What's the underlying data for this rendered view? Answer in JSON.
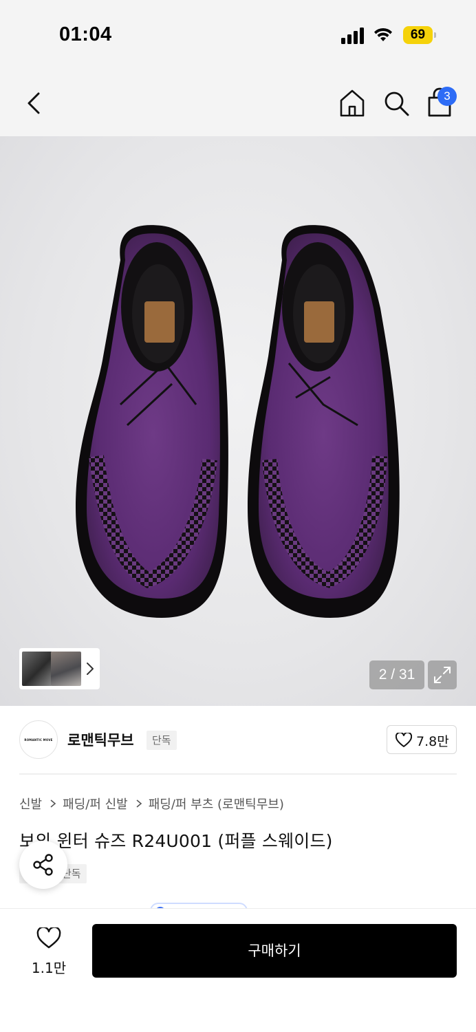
{
  "status_bar": {
    "time": "01:04",
    "battery": "69"
  },
  "nav": {
    "cart_count": "3"
  },
  "gallery": {
    "counter": "2 / 31"
  },
  "brand": {
    "name": "로맨틱무브",
    "tag": "단독",
    "logo_text": "ROMANTIC MOVE",
    "like_count": "7.8만"
  },
  "breadcrumb": [
    "신발",
    "패딩/퍼 신발",
    "패딩/퍼 부츠 (로맨틱무브)"
  ],
  "product": {
    "title": "보의 윈터 슈즈 R24U001 (퍼플 스웨이드)",
    "tag": "단독"
  },
  "bottom_bar": {
    "wish_count": "1.1만",
    "buy_label": "구매하기"
  },
  "colors": {
    "accent": "#2d6cf6",
    "battery": "#f5d20a",
    "product": "#5e2d76"
  }
}
